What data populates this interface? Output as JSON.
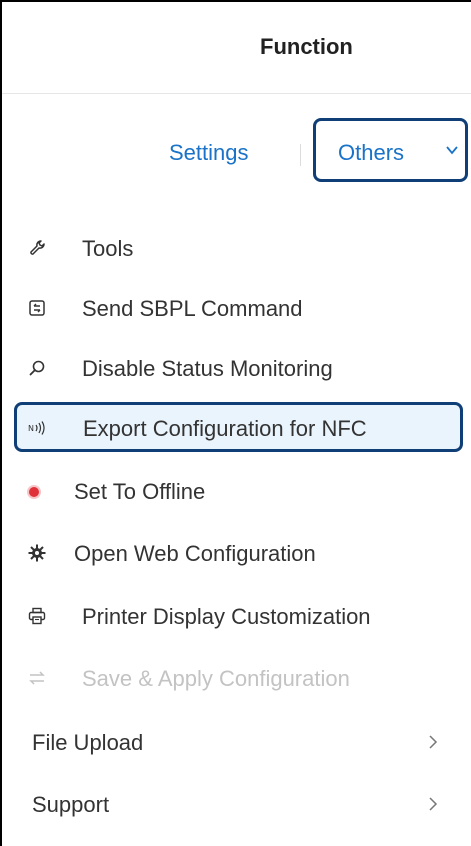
{
  "header": {
    "title": "Function"
  },
  "tabs": {
    "settings_label": "Settings",
    "others_label": "Others",
    "accent": "#1a73c8",
    "active_border": "#103f78"
  },
  "menu": {
    "items": [
      {
        "label": "Tools",
        "icon": "wrench-icon"
      },
      {
        "label": "Send SBPL Command",
        "icon": "command-box-icon"
      },
      {
        "label": "Disable Status Monitoring",
        "icon": "magnifier-icon"
      },
      {
        "label": "Export Configuration for NFC",
        "icon": "nfc-icon",
        "selected": true
      },
      {
        "label": "Set To Offline",
        "icon": "red-status-dot",
        "status_color": "#e0303a"
      },
      {
        "label": "Open Web Configuration",
        "icon": "gear-icon"
      },
      {
        "label": "Printer Display Customization",
        "icon": "printer-icon"
      },
      {
        "label": "Save & Apply Configuration",
        "icon": "swap-arrows-icon",
        "disabled": true
      },
      {
        "label": "File Upload",
        "icon": "chevron-right-icon",
        "submenu": true
      },
      {
        "label": "Support",
        "icon": "chevron-right-icon",
        "submenu": true
      }
    ]
  }
}
